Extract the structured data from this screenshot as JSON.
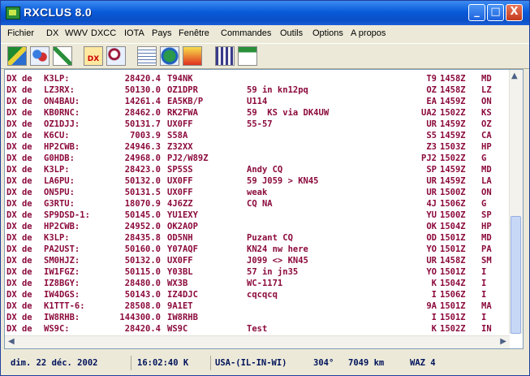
{
  "window": {
    "title": "RXCLUS 8.0",
    "minimize": "_",
    "maximize": "□",
    "close": "X"
  },
  "menu": [
    "Fichier",
    "DX",
    "WWV",
    "DXCC",
    "IOTA",
    "Pays",
    "Fenêtre",
    "Commandes",
    "Outils",
    "Options",
    "A propos"
  ],
  "toolbar": {
    "icons": [
      "map-icon",
      "people-icon",
      "antenna-icon",
      "dx-search-icon",
      "search-icon",
      "calendar-icon",
      "globe-icon",
      "alert-icon",
      "grid-icon",
      "window-icon"
    ],
    "dx_label": "DX"
  },
  "spots": [
    {
      "prefix": "DX de",
      "spotter": "K3LP:",
      "freq": "28420.4",
      "call": "T94NK",
      "comment": "",
      "country": "T9",
      "time": "1458Z",
      "extra": "MD"
    },
    {
      "prefix": "DX de",
      "spotter": "LZ3RX:",
      "freq": "50130.0",
      "call": "OZ1DPR",
      "comment": "59 in kn12pq",
      "country": "OZ",
      "time": "1458Z",
      "extra": "LZ"
    },
    {
      "prefix": "DX de",
      "spotter": "ON4BAU:",
      "freq": "14261.4",
      "call": "EA5KB/P",
      "comment": "U114",
      "country": "EA",
      "time": "1459Z",
      "extra": "ON"
    },
    {
      "prefix": "DX de",
      "spotter": "KB0RNC:",
      "freq": "28462.0",
      "call": "RK2FWA",
      "comment": "59  KS via DK4UW",
      "country": "UA2",
      "time": "1502Z",
      "extra": "KS"
    },
    {
      "prefix": "DX de",
      "spotter": "OZ1DJJ:",
      "freq": "50131.7",
      "call": "UX0FF",
      "comment": "55-57",
      "country": "UR",
      "time": "1459Z",
      "extra": "OZ"
    },
    {
      "prefix": "DX de",
      "spotter": "K6CU:",
      "freq": "7003.9",
      "call": "S58A",
      "comment": "",
      "country": "S5",
      "time": "1459Z",
      "extra": "CA"
    },
    {
      "prefix": "DX de",
      "spotter": "HP2CWB:",
      "freq": "24946.3",
      "call": "Z32XX",
      "comment": "",
      "country": "Z3",
      "time": "1503Z",
      "extra": "HP"
    },
    {
      "prefix": "DX de",
      "spotter": "G0HDB:",
      "freq": "24968.0",
      "call": "PJ2/W89Z",
      "comment": "",
      "country": "PJ2",
      "time": "1502Z",
      "extra": "G"
    },
    {
      "prefix": "DX de",
      "spotter": "K3LP:",
      "freq": "28423.0",
      "call": "SP5SS",
      "comment": "Andy CQ",
      "country": "SP",
      "time": "1459Z",
      "extra": "MD"
    },
    {
      "prefix": "DX de",
      "spotter": "LA6PU:",
      "freq": "50132.0",
      "call": "UX0FF",
      "comment": "59 J059 > KN45",
      "country": "UR",
      "time": "1459Z",
      "extra": "LA"
    },
    {
      "prefix": "DX de",
      "spotter": "ON5PU:",
      "freq": "50131.5",
      "call": "UX0FF",
      "comment": "weak",
      "country": "UR",
      "time": "1500Z",
      "extra": "ON"
    },
    {
      "prefix": "DX de",
      "spotter": "G3RTU:",
      "freq": "18070.9",
      "call": "4J6ZZ",
      "comment": "CQ NA",
      "country": "4J",
      "time": "1506Z",
      "extra": "G"
    },
    {
      "prefix": "DX de",
      "spotter": "SP9DSD-1:",
      "freq": "50145.0",
      "call": "YU1EXY",
      "comment": "",
      "country": "YU",
      "time": "1500Z",
      "extra": "SP"
    },
    {
      "prefix": "DX de",
      "spotter": "HP2CWB:",
      "freq": "24952.0",
      "call": "OK2AOP",
      "comment": "",
      "country": "OK",
      "time": "1504Z",
      "extra": "HP"
    },
    {
      "prefix": "DX de",
      "spotter": "K3LP:",
      "freq": "28435.8",
      "call": "OD5NH",
      "comment": "Puzant CQ",
      "country": "OD",
      "time": "1501Z",
      "extra": "MD"
    },
    {
      "prefix": "DX de",
      "spotter": "PA2UST:",
      "freq": "50160.0",
      "call": "Y07AQF",
      "comment": "KN24 nw here",
      "country": "YO",
      "time": "1501Z",
      "extra": "PA"
    },
    {
      "prefix": "DX de",
      "spotter": "SM0HJZ:",
      "freq": "50132.0",
      "call": "UX0FF",
      "comment": "J099 <> KN45",
      "country": "UR",
      "time": "1458Z",
      "extra": "SM"
    },
    {
      "prefix": "DX de",
      "spotter": "IW1FGZ:",
      "freq": "50115.0",
      "call": "Y03BL",
      "comment": "57 in jn35",
      "country": "YO",
      "time": "1501Z",
      "extra": "I"
    },
    {
      "prefix": "DX de",
      "spotter": "IZ8BGY:",
      "freq": "28480.0",
      "call": "WX3B",
      "comment": "WC-1171",
      "country": "K",
      "time": "1504Z",
      "extra": "I"
    },
    {
      "prefix": "DX de",
      "spotter": "IW4DGS:",
      "freq": "50143.0",
      "call": "IZ4DJC",
      "comment": "cqcqcq",
      "country": "I",
      "time": "1506Z",
      "extra": "I"
    },
    {
      "prefix": "DX de",
      "spotter": "K1TTT-6:",
      "freq": "28508.0",
      "call": "9A1ET",
      "comment": "",
      "country": "9A",
      "time": "1501Z",
      "extra": "MA"
    },
    {
      "prefix": "DX de",
      "spotter": "IW8RHB:",
      "freq": "144300.0",
      "call": "IW8RHB",
      "comment": "",
      "country": "I",
      "time": "1501Z",
      "extra": "I"
    },
    {
      "prefix": "DX de",
      "spotter": "WS9C:",
      "freq": "28420.4",
      "call": "WS9C",
      "comment": "Test",
      "country": "K",
      "time": "1502Z",
      "extra": "IN"
    }
  ],
  "status": {
    "date": "dim. 22 déc. 2002",
    "time": "16:02:40 K",
    "location": "USA-(IL-IN-WI)",
    "bearing": "304°",
    "distance": "7049 km",
    "zone": "WAZ 4"
  },
  "colors": {
    "spot_text": "#8b0a3c",
    "status_text": "#00135b",
    "titlebar": "#0a5bd9"
  }
}
